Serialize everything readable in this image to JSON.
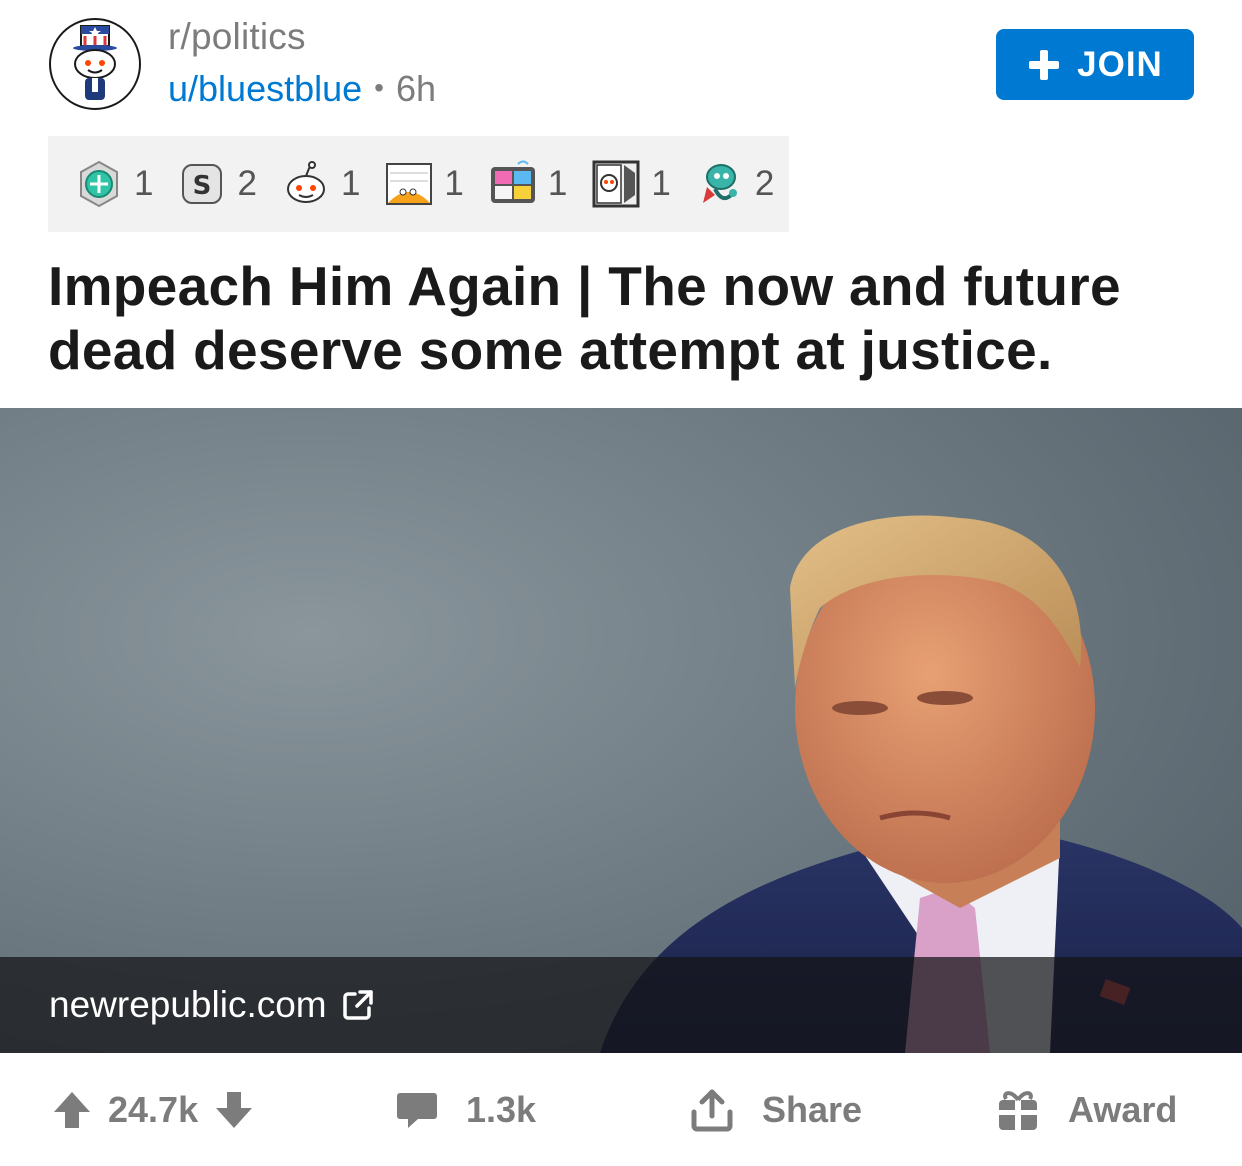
{
  "header": {
    "subreddit": "r/politics",
    "user": "u/bluestblue",
    "separator": "•",
    "age": "6h",
    "join_label": "JOIN"
  },
  "awards": [
    {
      "icon": "helpful-award-icon",
      "count": "1"
    },
    {
      "icon": "silver-coin-award-icon",
      "count": "2"
    },
    {
      "icon": "snoo-wholesome-award-icon",
      "count": "1"
    },
    {
      "icon": "doge-chart-award-icon",
      "count": "1"
    },
    {
      "icon": "robot-faces-award-icon",
      "count": "1"
    },
    {
      "icon": "snoo-window-award-icon",
      "count": "1"
    },
    {
      "icon": "teal-snoo-award-icon",
      "count": "2"
    }
  ],
  "post": {
    "title": "Impeach Him Again | The now and future dead deserve some attempt at justice.",
    "link_domain": "newrepublic.com"
  },
  "actions": {
    "upvotes": "24.7k",
    "comments": "1.3k",
    "share_label": "Share",
    "award_label": "Award"
  },
  "colors": {
    "accent": "#0079d3",
    "text": "#1a1a1b",
    "muted": "#7c7c7c",
    "awards_bg": "#f2f2f2"
  }
}
